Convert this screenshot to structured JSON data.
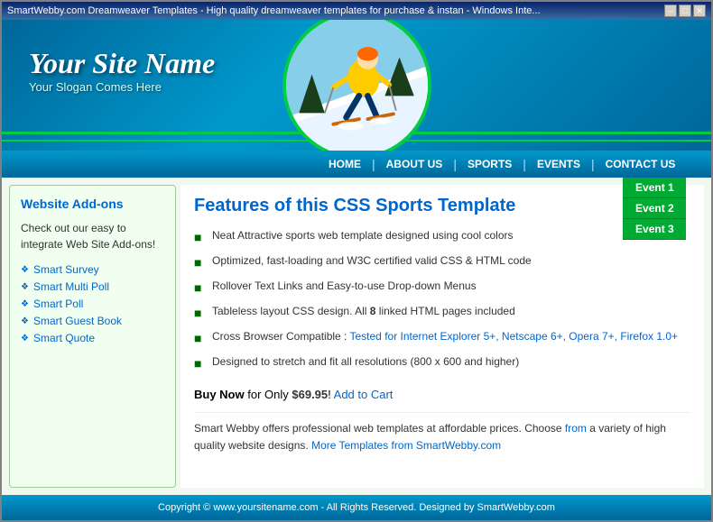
{
  "browser": {
    "title": "SmartWebby.com Dreamweaver Templates - High quality dreamweaver templates for purchase & instan - Windows Inte...",
    "min_btn": "–",
    "max_btn": "□",
    "close_btn": "✕"
  },
  "header": {
    "site_name": "Your Site Name",
    "slogan": "Your Slogan Comes Here"
  },
  "nav": {
    "items": [
      {
        "label": "HOME"
      },
      {
        "label": "ABOUT US"
      },
      {
        "label": "SPORTS"
      },
      {
        "label": "EVENTS"
      },
      {
        "label": "CONTACT US"
      }
    ],
    "dropdown": [
      {
        "label": "Event 1"
      },
      {
        "label": "Event 2"
      },
      {
        "label": "Event 3"
      }
    ]
  },
  "sidebar": {
    "title": "Website Add-ons",
    "description": "Check out our easy to integrate Web Site Add-ons!",
    "links": [
      {
        "label": "Smart Survey"
      },
      {
        "label": "Smart Multi Poll"
      },
      {
        "label": "Smart Poll"
      },
      {
        "label": "Smart Guest Book"
      },
      {
        "label": "Smart Quote"
      }
    ]
  },
  "content": {
    "title": "Features of this CSS Sports Template",
    "features": [
      "Neat Attractive sports web template designed using cool colors",
      "Optimized, fast-loading and W3C certified valid CSS & HTML code",
      "Rollover Text Links and Easy-to-use Drop-down Menus",
      "Tableless layout CSS design. All 8 linked HTML pages included",
      "Cross Browser Compatible : Tested for Internet Explorer 5+, Netscape 6+, Opera 7+, Firefox 1.0+",
      "Designed to stretch and fit all resolutions (800 x 600 and higher)"
    ],
    "cross_browser_prefix": "Cross Browser Compatible : ",
    "cross_browser_link": "Tested for Internet Explorer 5+, Netscape 6+, Opera 7+, Firefox 1.0+",
    "buy_label": "Buy Now",
    "buy_suffix": " for Only ",
    "price": "$69.95",
    "buy_suffix2": "! ",
    "cart_link": "Add to Cart",
    "promo_prefix": "Smart Webby offers professional web templates at affordable prices. Choose ",
    "promo_from": "from",
    "promo_middle": " a variety of high quality website designs. ",
    "promo_link": "More Templates from SmartWebby.com"
  },
  "footer": {
    "text": "Copyright © www.yoursitename.com - All Rights Reserved. Designed by SmartWebby.com"
  }
}
